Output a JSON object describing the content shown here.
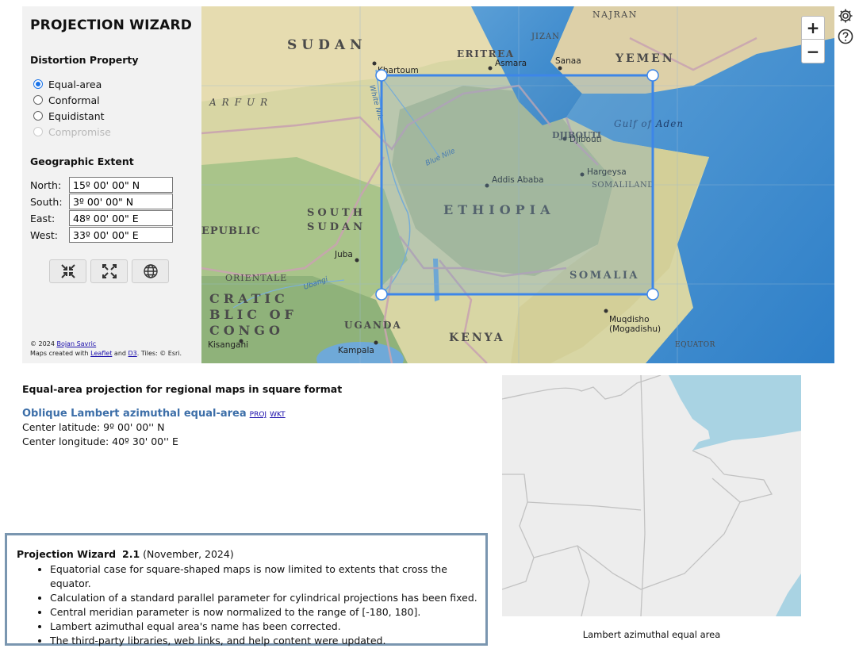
{
  "panel": {
    "title": "PROJECTION WIZARD",
    "distortion_label": "Distortion Property",
    "options": [
      {
        "label": "Equal-area",
        "checked": true,
        "disabled": false
      },
      {
        "label": "Conformal",
        "checked": false,
        "disabled": false
      },
      {
        "label": "Equidistant",
        "checked": false,
        "disabled": false
      },
      {
        "label": "Compromise",
        "checked": false,
        "disabled": true
      }
    ],
    "extent_label": "Geographic Extent",
    "extent": {
      "north_label": "North:",
      "north": "15º 00' 00\" N",
      "south_label": "South:",
      "south": "3º 00' 00\" N",
      "east_label": "East:",
      "east": "48º 00' 00\" E",
      "west_label": "West:",
      "west": "33º 00' 00\" E"
    },
    "tools": [
      "collapse-icon",
      "expand-icon",
      "globe-icon"
    ],
    "credits": {
      "copyright": "© 2024 ",
      "author": "Bojan Savric",
      "maps_prefix": "Maps created with ",
      "leaflet": "Leaflet",
      "and": " and ",
      "d3": "D3",
      "tiles": ". Tiles: © Esri."
    }
  },
  "map": {
    "zoom_in": "+",
    "zoom_out": "−",
    "labels": {
      "sudan": "SUDAN",
      "najran": "NAJRAN",
      "eritrea": "ERITREA",
      "jizan": "JIZAN",
      "yemen": "YEMEN",
      "khartoum": "Khartoum",
      "asmara": "Asmara",
      "sanaa": "Sanaa",
      "darfur": "ARFUR",
      "white_nile": "White Nile",
      "djibouti": "DJIBOUTI",
      "djibouti_city": "Djibouti",
      "gulf_aden": "Gulf of Aden",
      "hargeysa": "Hargeysa",
      "somaliland": "SOMALILAND",
      "addis": "Addis Ababa",
      "ethiopia": "ETHIOPIA",
      "south_sudan_1": "SOUTH",
      "south_sudan_2": "SUDAN",
      "republic": "EPUBLIC",
      "juba": "Juba",
      "somalia": "SOMALIA",
      "orientale": "ORIENTALE",
      "congo_1": "CRATIC",
      "congo_2": "BLIC OF",
      "congo_3": "CONGO",
      "uganda": "UGANDA",
      "kenya": "KENYA",
      "mogadishu_1": "Muqdisho",
      "mogadishu_2": "(Mogadishu)",
      "kisangani": "Kisangani",
      "kampala": "Kampala",
      "equator": "EQUATOR",
      "ubangi": "Ubangi",
      "blue_nile": "Blue Nile"
    }
  },
  "result": {
    "heading": "Equal-area projection for regional maps in square format",
    "projection_name": "Oblique Lambert azimuthal equal-area",
    "proj_link": "PROJ",
    "wkt_link": "WKT",
    "center_lat": "Center latitude: 9º 00' 00'' N",
    "center_lon": "Center longitude: 40º 30' 00'' E"
  },
  "preview": {
    "caption": "Lambert azimuthal equal area",
    "land_color": "#ededed",
    "water_color": "#a9d3e3"
  },
  "notes": {
    "name": "Projection Wizard",
    "version": "2.1",
    "date": " (November, 2024)",
    "items": [
      "Equatorial case for square-shaped maps is now limited to extents that cross the equator.",
      "Calculation of a standard parallel parameter for cylindrical projections has been fixed.",
      "Central meridian parameter is now normalized to the range of [-180, 180].",
      "Lambert azimuthal equal area's name has been corrected.",
      "The third-party libraries, web links, and help content were updated."
    ]
  },
  "colors": {
    "accent": "#1a73e8",
    "extent_box": "#3d86e8",
    "notes_border": "#7a96b0",
    "projection_name": "#3c6ea8"
  }
}
